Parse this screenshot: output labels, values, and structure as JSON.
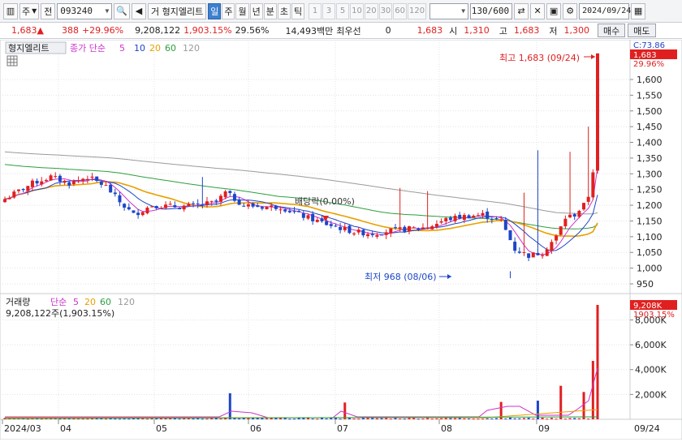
{
  "toolbar": {
    "market_label": "주",
    "prev_label": "전",
    "code": "093240",
    "name": "형지엘리트",
    "name_prefix": "거",
    "periods": [
      {
        "label": "일",
        "active": true
      },
      {
        "label": "주",
        "active": false
      },
      {
        "label": "월",
        "active": false
      },
      {
        "label": "년",
        "active": false
      },
      {
        "label": "분",
        "active": false
      },
      {
        "label": "초",
        "active": false
      },
      {
        "label": "틱",
        "active": false
      }
    ],
    "intervals": [
      "1",
      "3",
      "5",
      "10",
      "20",
      "30",
      "60",
      "120"
    ],
    "count": "130/600",
    "date": "2024/09/24"
  },
  "quote": {
    "price": "1,683",
    "change": "388",
    "change_pct": "+29.96%",
    "volume": "9,208,122",
    "volume_ratio": "1,903.15%",
    "turnover_ratio": "29.56%",
    "amount": "14,493백만",
    "best_bid_label": "최우선",
    "best_bid": "0",
    "last": "1,683",
    "open_label": "시",
    "open": "1,310",
    "high_label": "고",
    "high": "1,683",
    "low_label": "저",
    "low": "1,300",
    "buy_label": "매수",
    "sell_label": "매도"
  },
  "price_panel": {
    "stock_label": "형지엘리트",
    "ma_legend_title": "종가 단순",
    "ma_periods": [
      "5",
      "10",
      "20",
      "60",
      "120"
    ],
    "ma_colors": [
      "#cc33cc",
      "#1d46c8",
      "#e8a000",
      "#2e9e3e",
      "#9a9a9a"
    ],
    "high_annotation": "최고 1,683 (09/24)",
    "low_annotation": "최저 968 (08/06)",
    "dividend_annotation": "배당락(0.00%)",
    "axis_ticks": [
      "1,600",
      "1,550",
      "1,500",
      "1,450",
      "1,400",
      "1,350",
      "1,300",
      "1,250",
      "1,200",
      "1,150",
      "1,100",
      "1,050",
      "1,000",
      "950"
    ],
    "top_label_c": "C:73.86",
    "current_price_label": "1,683",
    "current_pct_label": "29.96%"
  },
  "volume_panel": {
    "title": "거래량",
    "ma_legend_title": "단순",
    "ma_periods": [
      "5",
      "20",
      "60",
      "120"
    ],
    "volume_text": "9,208,122주(1,903.15%)",
    "axis_ticks": [
      "8,000K",
      "6,000K",
      "4,000K",
      "2,000K"
    ],
    "current_label": "9,208K",
    "current_pct": "1903.15%"
  },
  "x_axis": {
    "labels": [
      "2024/03",
      "04",
      "05",
      "06",
      "07",
      "08",
      "09"
    ],
    "end_label": "09/24"
  },
  "chart_data": {
    "type": "candlestick",
    "y_range": [
      950,
      1683
    ],
    "volume_range": [
      0,
      9208122
    ],
    "months": [
      "2024/03",
      "04",
      "05",
      "06",
      "07",
      "08",
      "09"
    ],
    "high": {
      "value": 1683,
      "date": "09/24"
    },
    "low": {
      "value": 968,
      "date": "08/06"
    },
    "last_close": 1683,
    "last_volume": 9208122
  }
}
